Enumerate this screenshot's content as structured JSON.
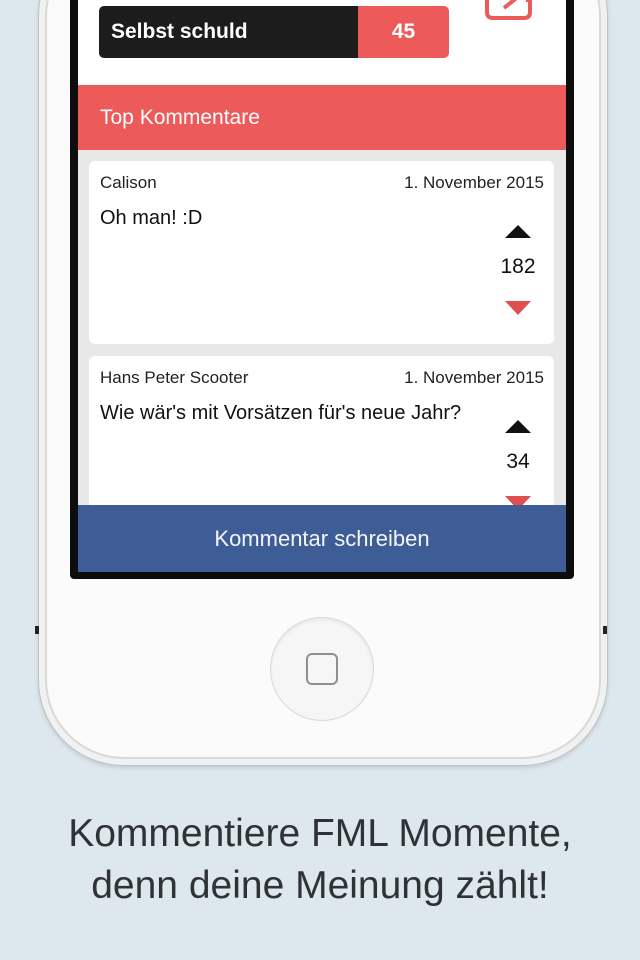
{
  "vote": {
    "label": "Selbst schuld",
    "count": "45"
  },
  "section": {
    "title": "Top Kommentare"
  },
  "comments": [
    {
      "author": "Calison",
      "date": "1. November 2015",
      "text": "Oh man! :D",
      "score": "182"
    },
    {
      "author": "Hans Peter Scooter",
      "date": "1. November 2015",
      "text": "Wie wär's mit Vorsätzen für's neue Jahr?",
      "score": "34"
    }
  ],
  "write_button": {
    "label": "Kommentar schreiben"
  },
  "caption": {
    "line1": "Kommentiere FML Momente,",
    "line2": "denn deine Meinung zählt!"
  },
  "icons": {
    "share": "share-icon",
    "upvote": "upvote-arrow-icon",
    "downvote": "downvote-arrow-icon",
    "home": "home-button-icon"
  },
  "colors": {
    "accent": "#ec5a5a",
    "dark_bar": "#1c1c1c",
    "primary_button": "#3e5d96",
    "background": "#dde7ee"
  }
}
